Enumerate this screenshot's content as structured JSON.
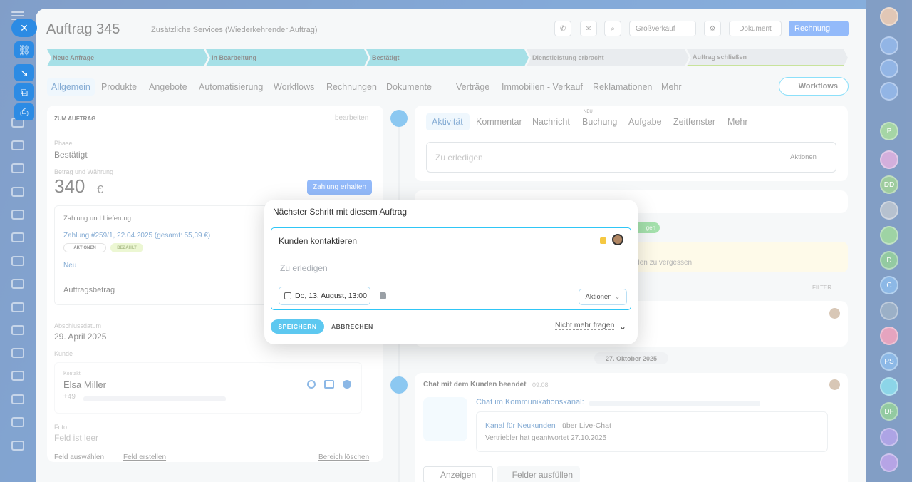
{
  "header": {
    "title": "Auftrag 345",
    "subtitle": "Zusätzliche Services (Wiederkehrender Auftrag)",
    "grossverkauf": "Großverkauf",
    "dokument": "Dokument",
    "rechnung": "Rechnung"
  },
  "stages": [
    "Neue Anfrage",
    "In Bearbeitung",
    "Bestätigt",
    "Dienstleistung erbracht",
    "Auftrag schließen"
  ],
  "tabs": [
    "Allgemein",
    "Produkte",
    "Angebote",
    "Automatisierung",
    "Workflows",
    "Rechnungen",
    "Dokumente",
    "Verträge",
    "Immobilien - Verkauf",
    "Reklamationen",
    "Mehr"
  ],
  "workflows_btn": "Workflows",
  "left": {
    "section": "ZUM AUFTRAG",
    "edit": "bearbeiten",
    "phase_label": "Phase",
    "phase": "Bestätigt",
    "amount_label": "Betrag und Währung",
    "amount": "340",
    "currency": "€",
    "pay_btn": "Zahlung erhalten",
    "pay_section": "Zahlung und Lieferung",
    "payment": "Zahlung #259/1, 22.04.2025 (gesamt: 55,39 €)",
    "badge_actions": "AKTIONEN",
    "badge_paid": "BEZAHLT",
    "neu": "Neu",
    "order_amount": "Auftragsbetrag",
    "close_label": "Abschlussdatum",
    "close": "29. April 2025",
    "customer_label": "Kunde",
    "contact_label": "Kontakt",
    "contact": "Elsa Miller",
    "phone": "+49",
    "photo_label": "Foto",
    "photo": "Feld ist leer",
    "field_select": "Feld auswählen",
    "field_create": "Feld erstellen",
    "area_delete": "Bereich löschen"
  },
  "right": {
    "tabs": [
      "Aktivität",
      "Kommentar",
      "Nachricht",
      "Buchung",
      "Aufgabe",
      "Zeitfenster",
      "Mehr"
    ],
    "new_badge": "NEU",
    "todo_placeholder": "Zu erledigen",
    "aktionen": "Aktionen",
    "reminder_tail": "n Kunden zu vergessen",
    "filter": "FILTER",
    "date_sep": "27. Oktober 2025",
    "chat_title": "Chat mit dem Kunden beendet",
    "chat_time": "09:08",
    "chat_channel": "Chat im Kommunikationskanal:",
    "kanal": "Kanal für Neukunden",
    "kanal_via": "über Live-Chat",
    "reply": "Vertriebler hat geantwortet 27.10.2025",
    "btn_show": "Anzeigen",
    "btn_fill": "Felder ausfüllen",
    "partial": "gen"
  },
  "popup": {
    "title": "Nächster Schritt mit diesem Auftrag",
    "task": "Kunden kontaktieren",
    "placeholder": "Zu erledigen",
    "date": "Do, 13. August, 13:00",
    "aktionen": "Aktionen",
    "save": "SPEICHERN",
    "cancel": "ABBRECHEN",
    "no_more": "Nicht mehr fragen"
  },
  "rightbar": {
    "avatars": [
      "P",
      "",
      "DD",
      "",
      "",
      "D",
      "C",
      "",
      "",
      "PS",
      "",
      "DF",
      "",
      ""
    ]
  }
}
